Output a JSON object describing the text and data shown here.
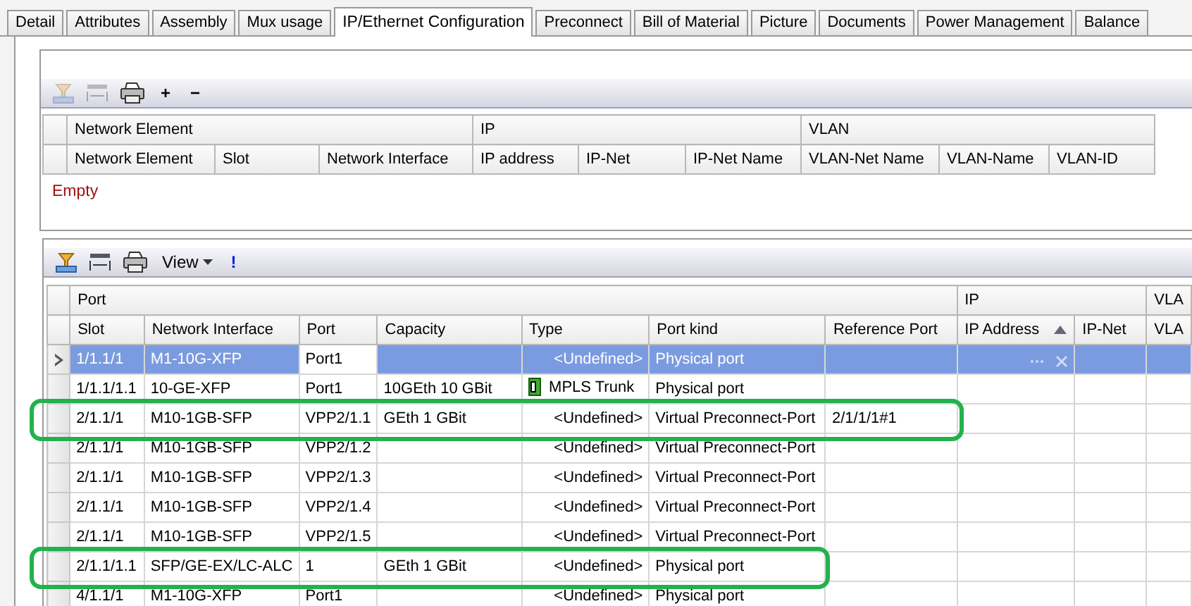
{
  "tabs": [
    {
      "label": "Detail",
      "selected": false
    },
    {
      "label": "Attributes",
      "selected": false
    },
    {
      "label": "Assembly",
      "selected": false
    },
    {
      "label": "Mux usage",
      "selected": false
    },
    {
      "label": "IP/Ethernet Configuration",
      "selected": true
    },
    {
      "label": "Preconnect",
      "selected": false
    },
    {
      "label": "Bill of Material",
      "selected": false
    },
    {
      "label": "Picture",
      "selected": false
    },
    {
      "label": "Documents",
      "selected": false
    },
    {
      "label": "Power Management",
      "selected": false
    },
    {
      "label": "Balance",
      "selected": false
    }
  ],
  "upper_grid": {
    "toolbar": [
      {
        "kind": "filter",
        "disabled": true
      },
      {
        "kind": "columns",
        "disabled": true
      },
      {
        "kind": "print",
        "disabled": false
      },
      {
        "kind": "text",
        "label": "+",
        "disabled": false
      },
      {
        "kind": "text",
        "label": "−",
        "disabled": false
      }
    ],
    "column_groups": [
      {
        "label": "Network Element",
        "columns": [
          "Network Element",
          "Slot",
          "Network Interface"
        ]
      },
      {
        "label": "IP",
        "columns": [
          "IP address",
          "IP-Net",
          "IP-Net Name"
        ]
      },
      {
        "label": "VLAN",
        "columns": [
          "VLAN-Net Name",
          "VLAN-Name",
          "VLAN-ID"
        ]
      }
    ],
    "empty_text": "Empty"
  },
  "lower_grid": {
    "toolbar": [
      {
        "kind": "filter",
        "disabled": false
      },
      {
        "kind": "columns",
        "disabled": false
      },
      {
        "kind": "print",
        "disabled": false
      },
      {
        "kind": "menu",
        "label": "View",
        "disabled": false
      },
      {
        "kind": "alert",
        "label": "!",
        "disabled": false
      }
    ],
    "column_groups": [
      {
        "label": "Port",
        "columns": [
          "Slot",
          "Network Interface",
          "Port",
          "Capacity",
          "Type",
          "Port kind",
          "Reference Port"
        ]
      },
      {
        "label": "IP",
        "columns": [
          "IP Address",
          "IP-Net"
        ]
      },
      {
        "label": "VLA",
        "columns": [
          "VLA"
        ]
      }
    ],
    "rows": [
      {
        "selected": true,
        "circled": false,
        "slot": "1/1.1/1",
        "interface": "M1-10G-XFP",
        "port": "Port1",
        "type": {
          "kind": "undefined",
          "label": "<Undefined>"
        },
        "port_kind": "Physical port"
      },
      {
        "selected": false,
        "circled": false,
        "slot": "1/1.1/1.1",
        "interface": "10-GE-XFP",
        "port": "Port1",
        "capacity": "10GEth 10 GBit",
        "type": {
          "kind": "trunk",
          "label": "MPLS Trunk"
        },
        "port_kind": "Physical port"
      },
      {
        "selected": false,
        "circled": true,
        "slot": "2/1.1/1",
        "interface": "M10-1GB-SFP",
        "port": "VPP2/1.1",
        "capacity": "GEth 1 GBit",
        "type": {
          "kind": "undefined",
          "label": "<Undefined>"
        },
        "port_kind": "Virtual Preconnect-Port",
        "reference_port": "2/1/1/1#1"
      },
      {
        "selected": false,
        "circled": false,
        "slot": "2/1.1/1",
        "interface": "M10-1GB-SFP",
        "port": "VPP2/1.2",
        "type": {
          "kind": "undefined",
          "label": "<Undefined>"
        },
        "port_kind": "Virtual Preconnect-Port"
      },
      {
        "selected": false,
        "circled": false,
        "slot": "2/1.1/1",
        "interface": "M10-1GB-SFP",
        "port": "VPP2/1.3",
        "type": {
          "kind": "undefined",
          "label": "<Undefined>"
        },
        "port_kind": "Virtual Preconnect-Port"
      },
      {
        "selected": false,
        "circled": false,
        "slot": "2/1.1/1",
        "interface": "M10-1GB-SFP",
        "port": "VPP2/1.4",
        "type": {
          "kind": "undefined",
          "label": "<Undefined>"
        },
        "port_kind": "Virtual Preconnect-Port"
      },
      {
        "selected": false,
        "circled": false,
        "slot": "2/1.1/1",
        "interface": "M10-1GB-SFP",
        "port": "VPP2/1.5",
        "type": {
          "kind": "undefined",
          "label": "<Undefined>"
        },
        "port_kind": "Virtual Preconnect-Port"
      },
      {
        "selected": false,
        "circled": true,
        "slot": "2/1.1/1.1",
        "interface": "SFP/GE-EX/LC-ALC",
        "port": "1",
        "capacity": "GEth 1 GBit",
        "type": {
          "kind": "undefined",
          "label": "<Undefined>"
        },
        "port_kind": "Physical port"
      },
      {
        "selected": false,
        "circled": false,
        "slot": "4/1.1/1",
        "interface": "M1-10G-XFP",
        "port": "Port1",
        "type": {
          "kind": "undefined",
          "label": "<Undefined>"
        },
        "port_kind": "Physical port"
      }
    ]
  }
}
